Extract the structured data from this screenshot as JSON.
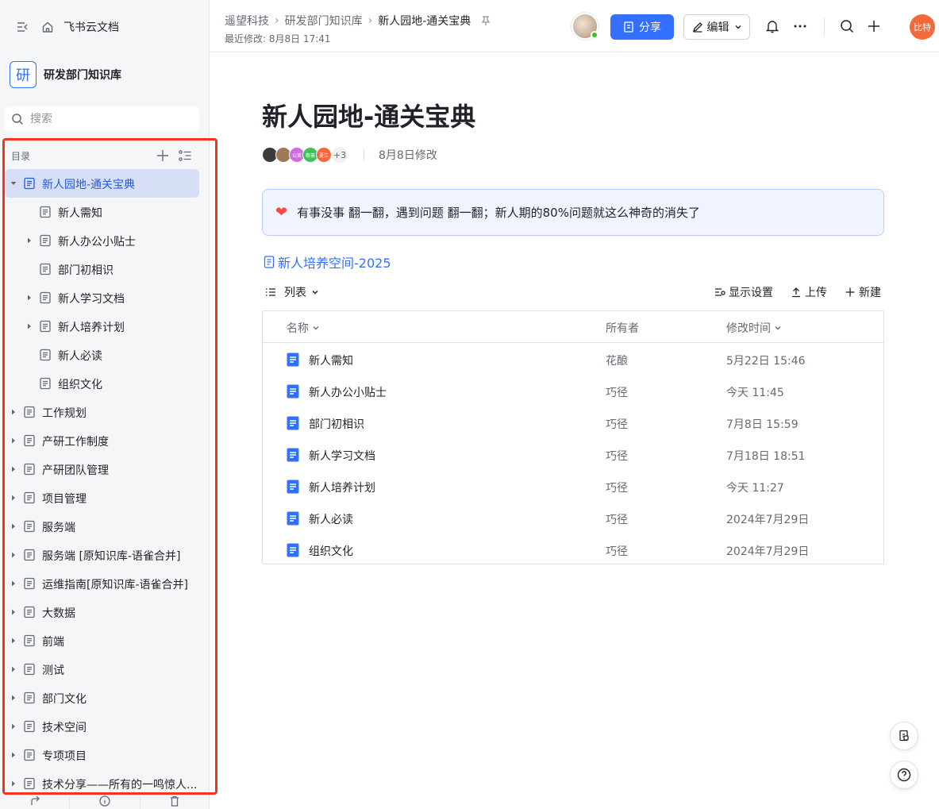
{
  "sidebar": {
    "app_name": "飞书云文档",
    "space_logo_char": "研",
    "space_name": "研发部门知识库",
    "search_placeholder": "搜索",
    "toc_label": "目录",
    "tree": [
      {
        "label": "新人园地-通关宝典",
        "level": 0,
        "caret": "down",
        "active": true
      },
      {
        "label": "新人需知",
        "level": 1,
        "caret": "none"
      },
      {
        "label": "新人办公小贴士",
        "level": 1,
        "caret": "right"
      },
      {
        "label": "部门初相识",
        "level": 1,
        "caret": "none"
      },
      {
        "label": "新人学习文档",
        "level": 1,
        "caret": "right"
      },
      {
        "label": "新人培养计划",
        "level": 1,
        "caret": "right"
      },
      {
        "label": "新人必读",
        "level": 1,
        "caret": "none"
      },
      {
        "label": "组织文化",
        "level": 1,
        "caret": "none"
      },
      {
        "label": "工作规划",
        "level": 0,
        "caret": "right"
      },
      {
        "label": "产研工作制度",
        "level": 0,
        "caret": "right"
      },
      {
        "label": "产研团队管理",
        "level": 0,
        "caret": "right"
      },
      {
        "label": "项目管理",
        "level": 0,
        "caret": "right"
      },
      {
        "label": "服务端",
        "level": 0,
        "caret": "right"
      },
      {
        "label": "服务端 [原知识库-语雀合并]",
        "level": 0,
        "caret": "right"
      },
      {
        "label": "运维指南[原知识库-语雀合并]",
        "level": 0,
        "caret": "right"
      },
      {
        "label": "大数据",
        "level": 0,
        "caret": "right"
      },
      {
        "label": "前端",
        "level": 0,
        "caret": "right"
      },
      {
        "label": "测试",
        "level": 0,
        "caret": "right"
      },
      {
        "label": "部门文化",
        "level": 0,
        "caret": "right"
      },
      {
        "label": "技术空间",
        "level": 0,
        "caret": "right"
      },
      {
        "label": "专项项目",
        "level": 0,
        "caret": "right"
      },
      {
        "label": "技术分享——所有的一鸣惊人...",
        "level": 0,
        "caret": "right"
      }
    ],
    "bottom_icons": [
      "share-icon",
      "info-icon",
      "trash-icon"
    ]
  },
  "header": {
    "breadcrumbs": [
      "遥望科技",
      "研发部门知识库",
      "新人园地-通关宝典"
    ],
    "last_modified": "最近修改: 8月8日 17:41",
    "share_label": "分享",
    "edit_label": "编辑",
    "me_avatar_text": "比特"
  },
  "doc": {
    "title": "新人园地-通关宝典",
    "collaborators": [
      {
        "text": "",
        "color": "#3b3b3b"
      },
      {
        "text": "",
        "color": "#a0785a"
      },
      {
        "text": "公英",
        "color": "#d16be0"
      },
      {
        "text": "敬豪",
        "color": "#3ec254"
      },
      {
        "text": "夏江",
        "color": "#f5683a"
      }
    ],
    "collaborators_more": "+3",
    "modified": "8月8日修改",
    "callout": "有事没事 翻一翻，遇到问题 翻一翻；新人期的80%问题就这么神奇的消失了",
    "linked_doc": "新人培养空间-2025",
    "view_label": "列表",
    "actions": {
      "display_settings": "显示设置",
      "upload": "上传",
      "new": "新建"
    },
    "columns": {
      "name": "名称",
      "owner": "所有者",
      "modified": "修改时间"
    },
    "rows": [
      {
        "name": "新人需知",
        "owner": "花酿",
        "time": "5月22日 15:46"
      },
      {
        "name": "新人办公小贴士",
        "owner": "巧径",
        "time": "今天 11:45"
      },
      {
        "name": "部门初相识",
        "owner": "巧径",
        "time": "7月8日 15:59"
      },
      {
        "name": "新人学习文档",
        "owner": "巧径",
        "time": "7月18日 18:51"
      },
      {
        "name": "新人培养计划",
        "owner": "巧径",
        "time": "今天 11:27"
      },
      {
        "name": "新人必读",
        "owner": "巧径",
        "time": "2024年7月29日"
      },
      {
        "name": "组织文化",
        "owner": "巧径",
        "time": "2024年7月29日"
      }
    ]
  },
  "colors": {
    "accent": "#3370ff",
    "highlight_border": "#f5331f",
    "active_row": "#d6dff5"
  }
}
